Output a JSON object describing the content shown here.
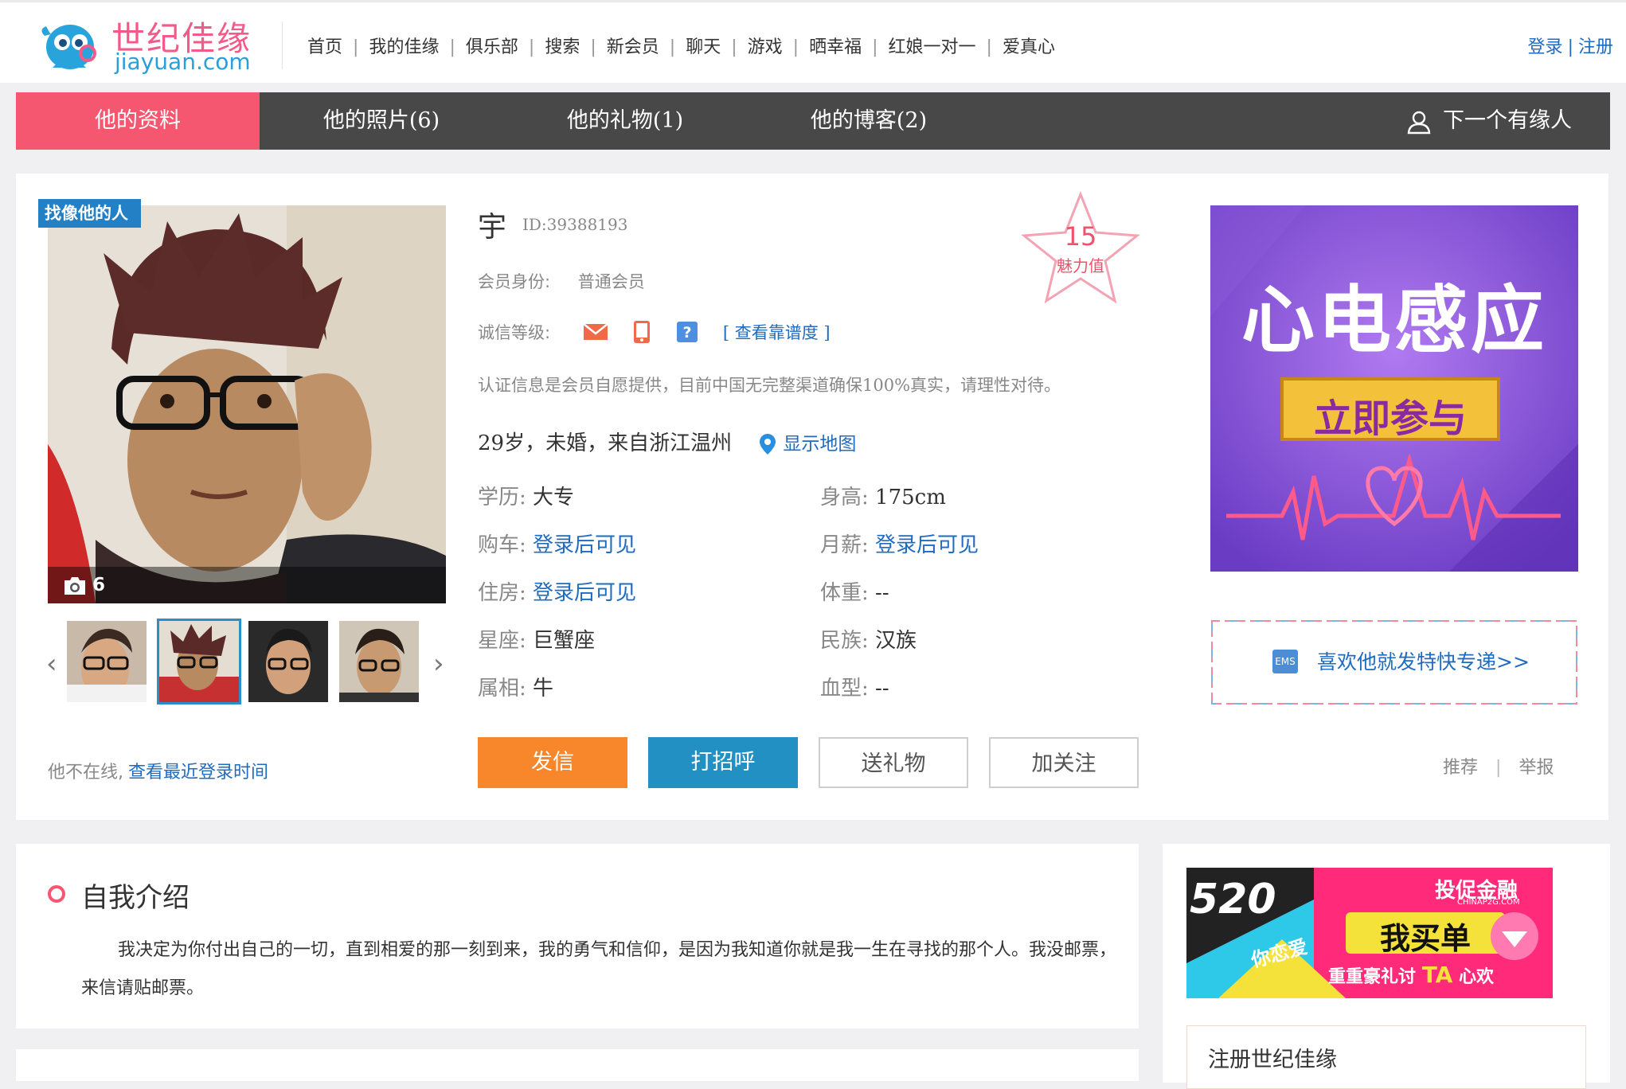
{
  "header": {
    "logo_cn": "世纪佳缘",
    "logo_en": "jiayuan.com",
    "nav": [
      "首页",
      "我的佳缘",
      "俱乐部",
      "搜索",
      "新会员",
      "聊天",
      "游戏",
      "晒幸福",
      "红娘一对一",
      "爱真心"
    ],
    "login": "登录",
    "register": "注册",
    "auth_separator": "|"
  },
  "tabs": [
    {
      "label": "他的资料",
      "active": true
    },
    {
      "label": "他的照片(6)",
      "active": false
    },
    {
      "label": "他的礼物(1)",
      "active": false
    },
    {
      "label": "他的博客(2)",
      "active": false
    }
  ],
  "next_person": "下一个有缘人",
  "photo": {
    "tag": "找像他的人",
    "count": "6"
  },
  "profile": {
    "nickname": "宇",
    "id": "ID:39388193",
    "charm_value": "15",
    "charm_label": "魅力值",
    "member_label": "会员身份:",
    "member_value": "普通会员",
    "credit_label": "诚信等级:",
    "credit_link": "[ 查看靠谱度 ]",
    "disclaimer": "认证信息是会员自愿提供，目前中国无完整渠道确保100%真实，请理性对待。",
    "summary": "29岁，未婚，来自浙江温州",
    "map_link": "显示地图",
    "fields": [
      {
        "label": "学历:",
        "value": "大专",
        "link": false
      },
      {
        "label": "身高:",
        "value": "175cm",
        "link": false
      },
      {
        "label": "购车:",
        "value": "登录后可见",
        "link": true
      },
      {
        "label": "月薪:",
        "value": "登录后可见",
        "link": true
      },
      {
        "label": "住房:",
        "value": "登录后可见",
        "link": true
      },
      {
        "label": "体重:",
        "value": "--",
        "link": false
      },
      {
        "label": "星座:",
        "value": "巨蟹座",
        "link": false
      },
      {
        "label": "民族:",
        "value": "汉族",
        "link": false
      },
      {
        "label": "属相:",
        "value": "牛",
        "link": false
      },
      {
        "label": "血型:",
        "value": "--",
        "link": false
      }
    ],
    "buttons": {
      "send_letter": "发信",
      "greet": "打招呼",
      "send_gift": "送礼物",
      "follow": "加关注"
    },
    "offline_text": "他不在线,",
    "last_login_link": "查看最近登录时间"
  },
  "ads": {
    "ad1_title": "心电感应",
    "ad1_button": "立即参与",
    "ems_badge": "EMS",
    "ems_text": "喜欢他就发特快专递>>",
    "recommend": "推荐",
    "report": "举报",
    "ad2_brand": "投促金融",
    "ad2_brand_url": "CHINAP2G.COM",
    "ad2_number": "520",
    "ad2_main": "我买单",
    "ad2_left": "你恋爱",
    "ad2_sub": "重重豪礼讨",
    "ad2_ta": "TA",
    "ad2_end": "心欢"
  },
  "intro": {
    "title": "自我介绍",
    "text": "我决定为你付出自己的一切，直到相爱的那一刻到来，我的勇气和信仰，是因为我知道你就是我一生在寻找的那个人。我没邮票，来信请贴邮票。"
  },
  "register_box": {
    "title": "注册世纪佳缘"
  },
  "colors": {
    "accent_pink": "#f55770",
    "link_blue": "#1e6bbf",
    "orange_button": "#f8862a",
    "teal_button": "#2290c2",
    "tab_bar": "#484848"
  }
}
